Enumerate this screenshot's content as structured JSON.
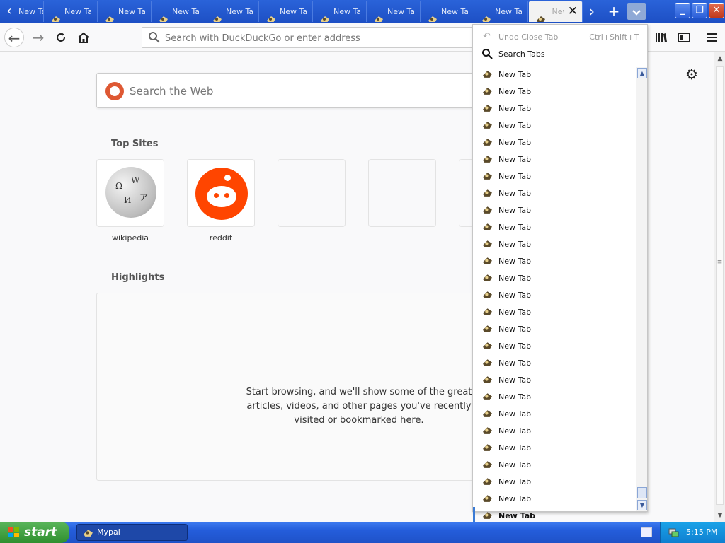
{
  "window": {
    "title": "Mypal"
  },
  "tabs": {
    "items": [
      "New Tab",
      "New Tab",
      "New Tab",
      "New Tab",
      "New Tab",
      "New Tab",
      "New Tab",
      "New Tab",
      "New Tab",
      "New Tab"
    ],
    "first_partial_label": "New Tab",
    "active_label": "New Tab",
    "scroll_left_icon": "chevron-left-icon",
    "scroll_right_icon": "chevron-right-icon",
    "new_tab_icon": "plus-icon",
    "all_tabs_icon": "chevron-down-icon"
  },
  "navbar": {
    "url_placeholder": "Search with DuckDuckGo or enter address"
  },
  "newtab": {
    "search_placeholder": "Search the Web",
    "top_sites_title": "Top Sites",
    "top_sites": [
      {
        "label": "wikipedia"
      },
      {
        "label": "reddit"
      }
    ],
    "highlights_title": "Highlights",
    "highlights_message": "Start browsing, and we'll show some of the great articles, videos, and other pages you've recently visited or bookmarked here."
  },
  "alltabs_menu": {
    "undo_label": "Undo Close Tab",
    "undo_shortcut": "Ctrl+Shift+T",
    "search_label": "Search Tabs",
    "tab_items": [
      "New Tab",
      "New Tab",
      "New Tab",
      "New Tab",
      "New Tab",
      "New Tab",
      "New Tab",
      "New Tab",
      "New Tab",
      "New Tab",
      "New Tab",
      "New Tab",
      "New Tab",
      "New Tab",
      "New Tab",
      "New Tab",
      "New Tab",
      "New Tab",
      "New Tab",
      "New Tab",
      "New Tab",
      "New Tab",
      "New Tab",
      "New Tab",
      "New Tab",
      "New Tab"
    ],
    "selected_label": "New Tab"
  },
  "taskbar": {
    "start_label": "start",
    "task_label": "Mypal",
    "clock": "5:15 PM"
  },
  "colors": {
    "titlebar": "#2a63d9",
    "reddit": "#ff4500",
    "duckduckgo": "#de5833",
    "start_green": "#3a9a3a",
    "tray": "#0f7fd0"
  }
}
